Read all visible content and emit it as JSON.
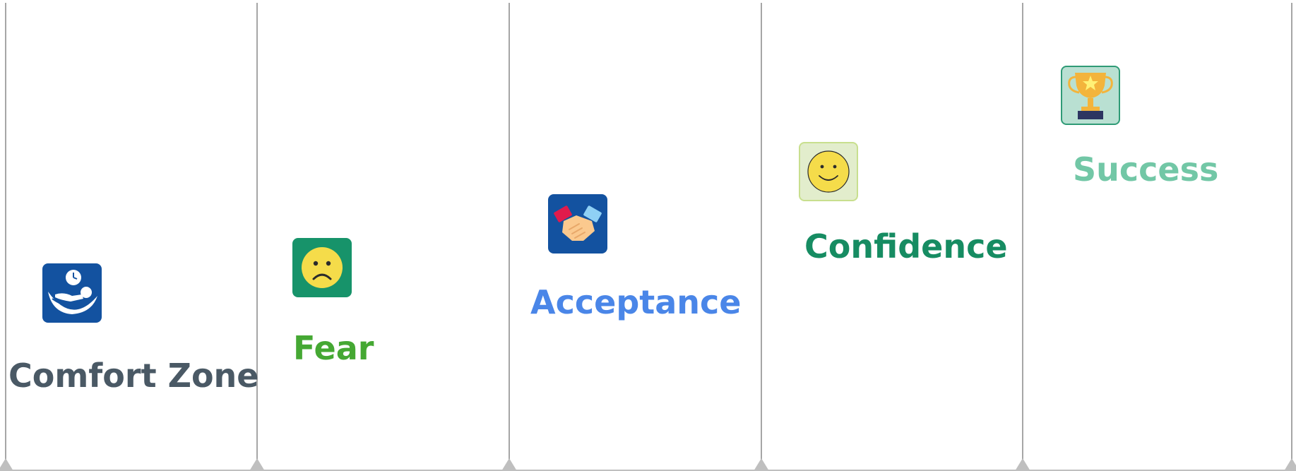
{
  "stages": [
    {
      "label": "Comfort Zone",
      "color": "#4a5965",
      "icon": "hammock-relax-icon",
      "tile_color": "#1352a0"
    },
    {
      "label": "Fear",
      "color": "#45a833",
      "icon": "sad-face-icon",
      "tile_color": "#17936a"
    },
    {
      "label": "Acceptance",
      "color": "#4a86e8",
      "icon": "handshake-icon",
      "tile_color": "#1352a0"
    },
    {
      "label": "Confidence",
      "color": "#168c62",
      "icon": "smiley-face-icon",
      "tile_color": "#e2edcc"
    },
    {
      "label": "Success",
      "color": "#72c7a6",
      "icon": "trophy-icon",
      "tile_color": "#b9e0d2"
    }
  ],
  "colors": {
    "divider": "#a6a6a6",
    "marker": "#bfbfbf",
    "face_yellow": "#f5dc4a"
  }
}
